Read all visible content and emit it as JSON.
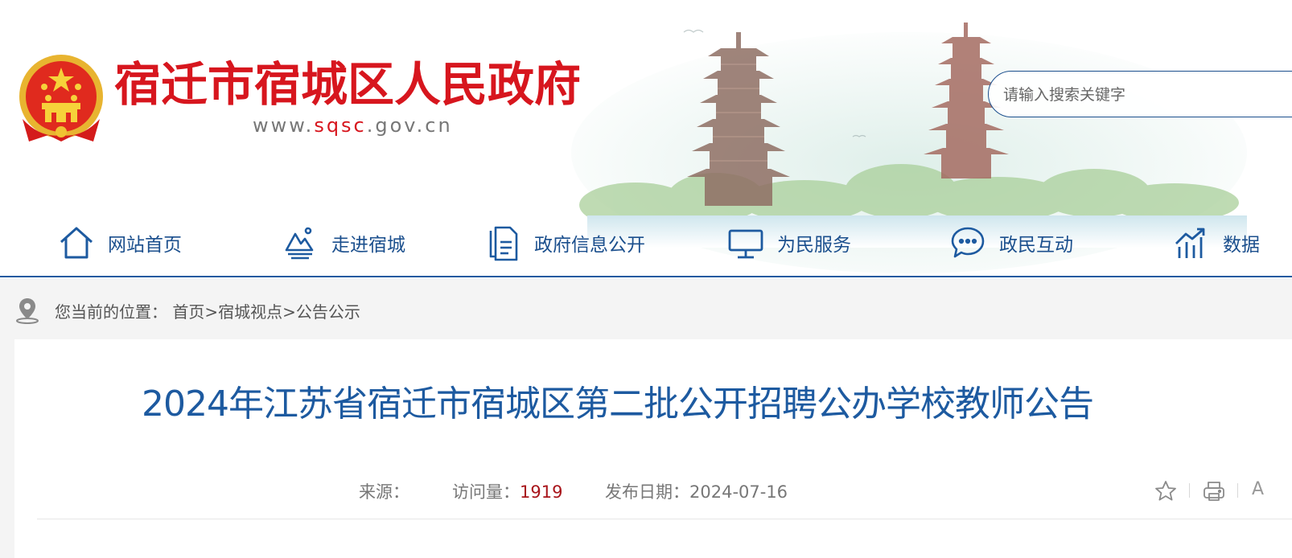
{
  "header": {
    "site_title": "宿迁市宿城区人民政府",
    "site_url_prefix": "www.",
    "site_url_highlight": "sqsc",
    "site_url_suffix": ".gov.cn",
    "search_placeholder": "请输入搜索关键字"
  },
  "nav": {
    "items": [
      {
        "label": "网站首页",
        "icon": "home-icon"
      },
      {
        "label": "走进宿城",
        "icon": "landscape-icon"
      },
      {
        "label": "政府信息公开",
        "icon": "document-icon"
      },
      {
        "label": "为民服务",
        "icon": "monitor-icon"
      },
      {
        "label": "政民互动",
        "icon": "chat-icon"
      },
      {
        "label": "数据",
        "icon": "data-chart-icon"
      }
    ]
  },
  "breadcrumb": {
    "prefix": "您当前的位置：",
    "items": [
      "首页",
      "宿城视点",
      "公告公示"
    ],
    "separator": ">"
  },
  "article": {
    "title": "2024年江苏省宿迁市宿城区第二批公开招聘公办学校教师公告",
    "source_label": "来源：",
    "views_label": "访问量：",
    "views_value": "1919",
    "date_label": "发布日期：",
    "date_value": "2024-07-16",
    "font_size_glyph": "A"
  },
  "colors": {
    "brand_red": "#d7161e",
    "brand_blue": "#1d5aa0",
    "nav_text": "#1b4f8d",
    "views_number": "#a8141a"
  }
}
